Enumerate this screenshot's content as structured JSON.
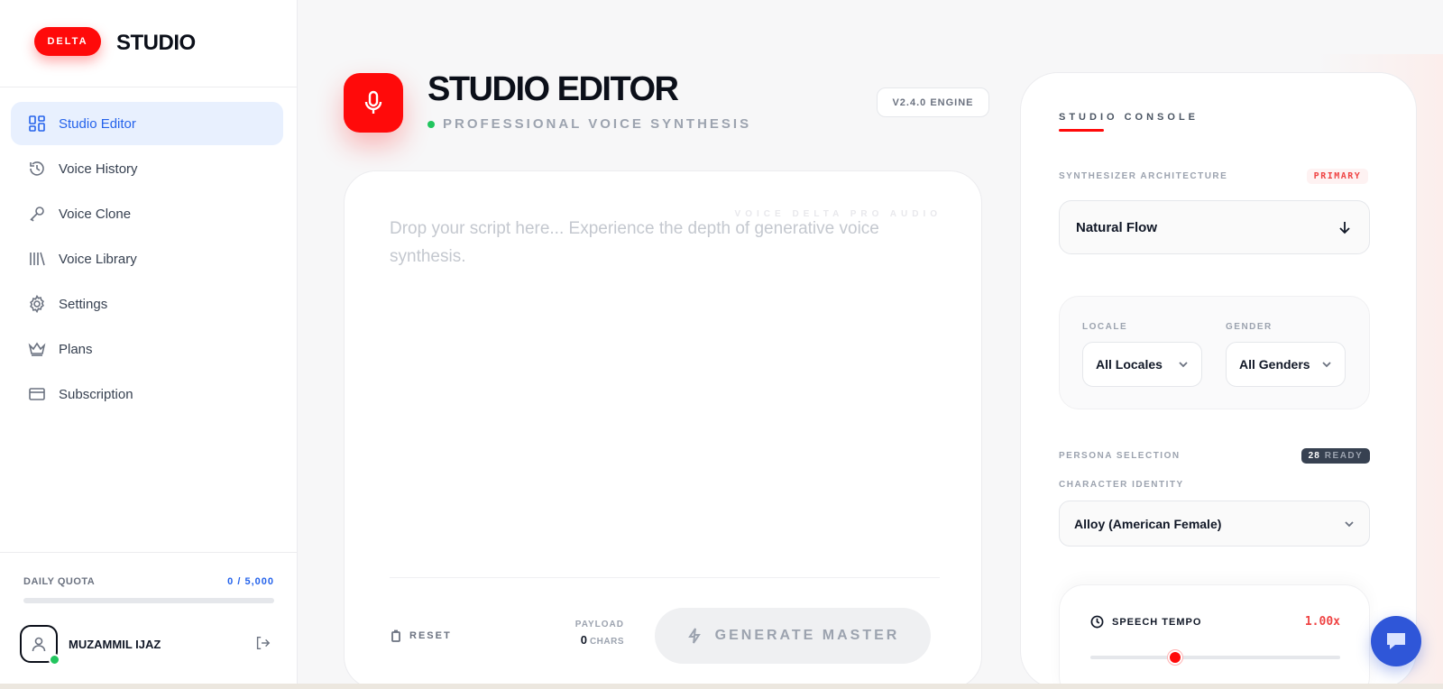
{
  "brand": {
    "pill": "DELTA",
    "name": "STUDIO"
  },
  "nav": [
    {
      "label": "Studio Editor",
      "icon": "dashboard-icon",
      "active": true
    },
    {
      "label": "Voice History",
      "icon": "history-icon"
    },
    {
      "label": "Voice Clone",
      "icon": "microphone-icon"
    },
    {
      "label": "Voice Library",
      "icon": "library-icon"
    },
    {
      "label": "Settings",
      "icon": "gear-icon"
    },
    {
      "label": "Plans",
      "icon": "crown-icon"
    },
    {
      "label": "Subscription",
      "icon": "credit-card-icon"
    }
  ],
  "quota": {
    "label": "DAILY QUOTA",
    "value": "0 / 5,000",
    "fraction": 0
  },
  "user": {
    "name": "MUZAMMIL IJAZ"
  },
  "header": {
    "title": "STUDIO EDITOR",
    "subtitle": "PROFESSIONAL VOICE SYNTHESIS",
    "engine": "V2.4.0 ENGINE"
  },
  "editor": {
    "watermark": "VOICE DELTA PRO AUDIO",
    "placeholder": "Drop your script here... Experience the depth of generative voice synthesis.",
    "value": "",
    "reset_label": "RESET",
    "payload_label": "PAYLOAD",
    "payload_value": "0",
    "payload_unit": "CHARS",
    "generate_label": "GENERATE MASTER"
  },
  "console": {
    "title": "STUDIO CONSOLE",
    "architecture_label": "SYNTHESIZER ARCHITECTURE",
    "architecture_badge": "PRIMARY",
    "architecture_value": "Natural Flow",
    "locale_label": "LOCALE",
    "locale_value": "All Locales",
    "gender_label": "GENDER",
    "gender_value": "All Genders",
    "persona_label": "PERSONA SELECTION",
    "persona_count": "28",
    "persona_ready": "READY",
    "character_label": "CHARACTER IDENTITY",
    "character_value": "Alloy (American Female)",
    "tempo_label": "SPEECH TEMPO",
    "tempo_value": "1.00x",
    "tempo_fraction": 0.34
  },
  "colors": {
    "accent": "#ff0a0a",
    "blue": "#2563eb",
    "chat": "#2f56d8"
  }
}
